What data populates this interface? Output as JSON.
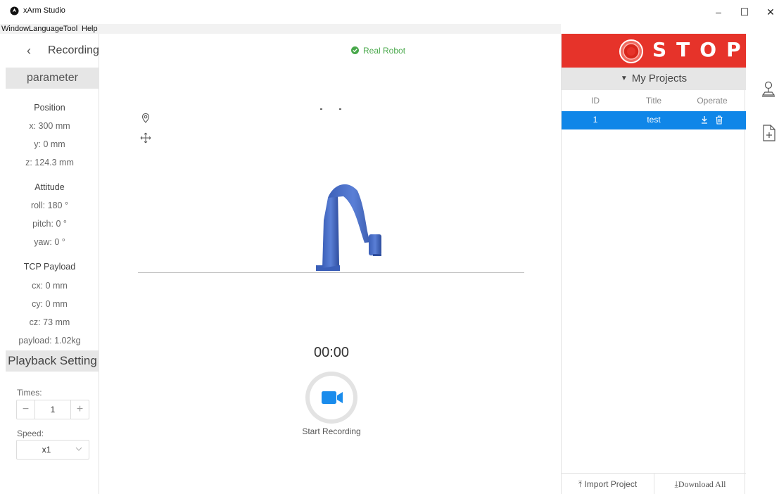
{
  "window": {
    "title": "xArm Studio",
    "minimize_glyph": "–",
    "maximize_glyph": "☐",
    "close_glyph": "✕"
  },
  "menu": [
    "Window",
    "Language",
    "Tool",
    "Help"
  ],
  "left": {
    "back_glyph": "‹",
    "title": "Recording",
    "parameter_header": "parameter",
    "position_label": "Position",
    "position": {
      "x": "x:  300   mm",
      "y": "y:    0    mm",
      "z": "z: 124.3 mm"
    },
    "attitude_label": "Attitude",
    "attitude": {
      "roll": "roll:  180 °",
      "pitch": "pitch:   0 °",
      "yaw": "yaw:   0 °"
    },
    "payload_label": "TCP Payload",
    "payload": {
      "cx": "cx:    0    mm",
      "cy": "cy:    0    mm",
      "cz": "cz:   73   mm",
      "payload": "payload: 1.02kg"
    },
    "playback_header": "Playback Setting",
    "times_label": "Times:",
    "times_minus": "−",
    "times_value": "1",
    "times_plus": "+",
    "speed_label": "Speed:",
    "speed_value": "x1"
  },
  "center": {
    "status": "Real Robot",
    "status_color": "#49a84b",
    "timer": "00:00",
    "record_label": "Start Recording",
    "record_icon": "video-camera-icon",
    "accent": "#1a8cec"
  },
  "right": {
    "stop_label": "STOP",
    "stop_color": "#e6332a",
    "projects_caret": "▼",
    "projects_header": "My Projects",
    "columns": [
      "ID",
      "Title",
      "Operate"
    ],
    "rows": [
      {
        "id": "1",
        "title": "test"
      }
    ],
    "selected_row_color": "#0f86e8",
    "import_label": "⤒ Import Project",
    "download_all_label": "⤓Download All"
  },
  "sidebar_icons": [
    "joystick-icon",
    "add-file-icon"
  ]
}
